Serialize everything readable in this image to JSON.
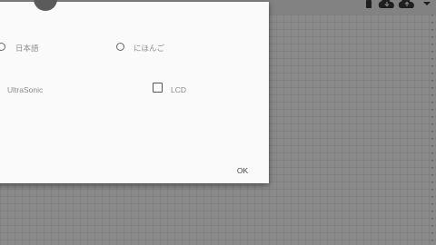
{
  "options": {
    "lang_japanese_label": "日本語",
    "lang_hiragana_label": "にほんご",
    "ultrasonic_label": "UltraSonic",
    "lcd_label": "LCD"
  },
  "dialog": {
    "ok_label": "OK"
  },
  "toolbar": {
    "icons": [
      "phone-icon",
      "cloud-download-icon",
      "cloud-upload-icon",
      "dropdown-arrow-icon"
    ]
  },
  "colors": {
    "dialog_bg": "#fafafa",
    "backdrop": "#8a8a8a",
    "toolbar": "#828282",
    "label_text": "#8c8c8c",
    "icon_dark": "#222222"
  }
}
